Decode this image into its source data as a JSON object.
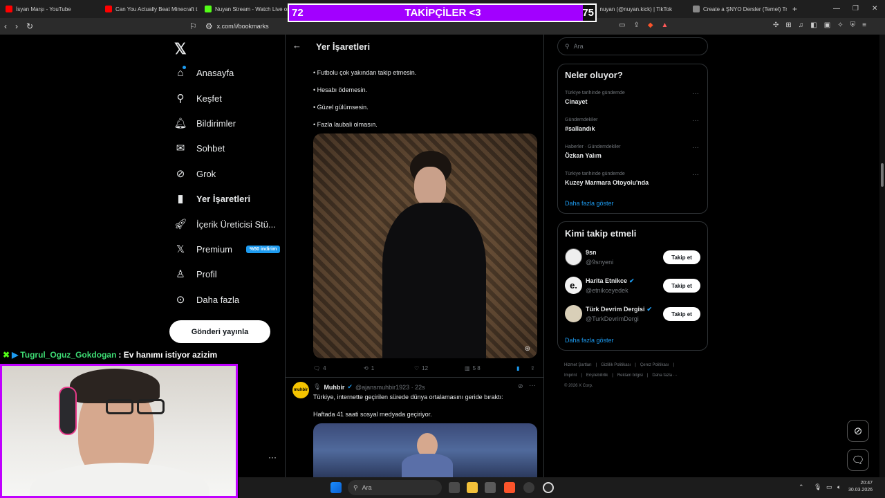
{
  "browser": {
    "tabs": [
      {
        "label": "İsyan Marşı - YouTube",
        "color": "#ff0000"
      },
      {
        "label": "Can You Actually Beat Minecraft t",
        "color": "#ff0000"
      },
      {
        "label": "Nuyan Stream - Watch Live on",
        "color": "#53fc18"
      },
      {
        "label": "nuyan (@nuyan.kick) | TikTok",
        "color": "#ffffff"
      },
      {
        "label": "Create a ŞNYO Dersler (Temel) Tr",
        "color": "#888888"
      }
    ],
    "url": "x.com/i/bookmarks"
  },
  "overlay": {
    "left_value": "72",
    "title": "TAKİPÇİLER <3",
    "right_value": "75",
    "progress_fraction": 0.96
  },
  "nav": {
    "items": [
      {
        "label": "Anasayfa",
        "icon": "home-icon"
      },
      {
        "label": "Keşfet",
        "icon": "search-icon"
      },
      {
        "label": "Bildirimler",
        "icon": "bell-icon"
      },
      {
        "label": "Sohbet",
        "icon": "mail-icon"
      },
      {
        "label": "Grok",
        "icon": "grok-icon"
      },
      {
        "label": "Yer İşaretleri",
        "icon": "bookmark-icon"
      },
      {
        "label": "İçerik Üreticisi Stü...",
        "icon": "rocket-icon"
      },
      {
        "label": "Premium",
        "icon": "x-logo-icon"
      },
      {
        "label": "Profil",
        "icon": "person-icon"
      },
      {
        "label": "Daha fazla",
        "icon": "more-circle-icon"
      }
    ],
    "premium_badge": "%50 indirim",
    "post_button": "Gönderi yayınla"
  },
  "chat": {
    "username": "Tugrul_Oguz_Gokdogan",
    "message": ": Ev hanımı istiyor azizim"
  },
  "center": {
    "header": "Yer İşaretleri",
    "bullets": [
      "• Futbolu çok yakından takip etmesin.",
      "• Hesabı ödemesin.",
      "• Güzel gülümsesin.",
      "• Fazla laubali olmasın."
    ],
    "actions": {
      "replies": "4",
      "reposts": "1",
      "likes": "12",
      "views": "5 8"
    },
    "tweet2": {
      "author": "Muhbir",
      "handle": "@ajansmuhbir1923 · 22s",
      "avatar_text": "muhbir",
      "text1": "Türkiye, internette geçirilen sürede dünya ortalamasını geride bıraktı:",
      "text2": "Haftada 41 saati sosyal medyada geçiriyor."
    }
  },
  "right": {
    "search_placeholder": "Ara",
    "trends_title": "Neler oluyor?",
    "trends": [
      {
        "context": "Türkiye tarihinde gündemde",
        "name": "Cinayet"
      },
      {
        "context": "Gündemdekiler",
        "name": "#sallandık"
      },
      {
        "context": "Haberler · Gündemdekiler",
        "name": "Özkan Yalım"
      },
      {
        "context": "Türkiye tarihinde gündemde",
        "name": "Kuzey Marmara Otoyolu'nda"
      }
    ],
    "show_more": "Daha fazla göster",
    "follow_title": "Kimi takip etmeli",
    "follow": [
      {
        "name": "9sn",
        "handle": "@9snyeni",
        "verified": false
      },
      {
        "name": "Harita Etnikce",
        "handle": "@etnikceyedek",
        "verified": true
      },
      {
        "name": "Türk Devrim Dergisi",
        "handle": "@TurkDevrimDergi",
        "verified": true
      }
    ],
    "follow_button": "Takip et",
    "footer": {
      "links1": [
        "Hizmet Şartları",
        "Gizlilik Politikası",
        "Çerez Politikası"
      ],
      "links2": [
        "Imprint",
        "Erişilebilirlik",
        "Reklam bilgisi",
        "Daha fazla ···"
      ],
      "copyright": "© 2026 X Corp."
    }
  },
  "taskbar": {
    "search_placeholder": "Ara",
    "time": "20:47",
    "date": "30.03.2026"
  }
}
